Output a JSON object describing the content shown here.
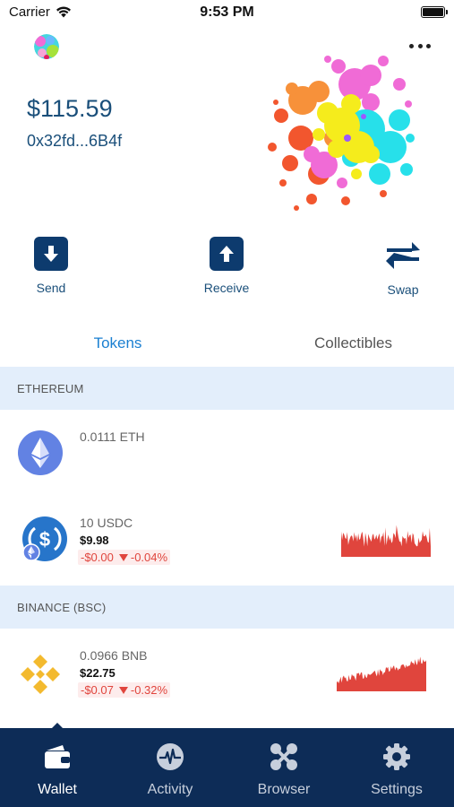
{
  "status_bar": {
    "carrier": "Carrier",
    "time": "9:53 PM"
  },
  "wallet": {
    "balance": "$115.59",
    "address": "0x32fd...6B4f"
  },
  "actions": {
    "send": "Send",
    "receive": "Receive",
    "swap": "Swap"
  },
  "tabs": {
    "tokens": "Tokens",
    "collectibles": "Collectibles",
    "active": "tokens"
  },
  "sections": [
    {
      "name": "ETHEREUM",
      "tokens": [
        {
          "amount": "0.0111 ETH",
          "icon": "ethereum-icon"
        },
        {
          "amount": "10 USDC",
          "fiat": "$9.98",
          "change": "-$0.00",
          "change_pct": "-0.04%",
          "icon": "usdc-icon"
        }
      ]
    },
    {
      "name": "BINANCE (BSC)",
      "tokens": [
        {
          "amount": "0.0966 BNB",
          "fiat": "$22.75",
          "change": "-$0.07",
          "change_pct": "-0.32%",
          "icon": "bnb-icon"
        }
      ]
    }
  ],
  "bottom_nav": [
    {
      "label": "Wallet",
      "icon": "wallet-icon",
      "active": true
    },
    {
      "label": "Activity",
      "icon": "activity-icon",
      "active": false
    },
    {
      "label": "Browser",
      "icon": "browser-icon",
      "active": false
    },
    {
      "label": "Settings",
      "icon": "gear-icon",
      "active": false
    }
  ],
  "colors": {
    "primary": "#0d3b6e",
    "nav_background": "#0d2c57",
    "accent_blue": "#1a7fd1",
    "negative": "#e0453d",
    "section_background": "#e3eefb"
  }
}
